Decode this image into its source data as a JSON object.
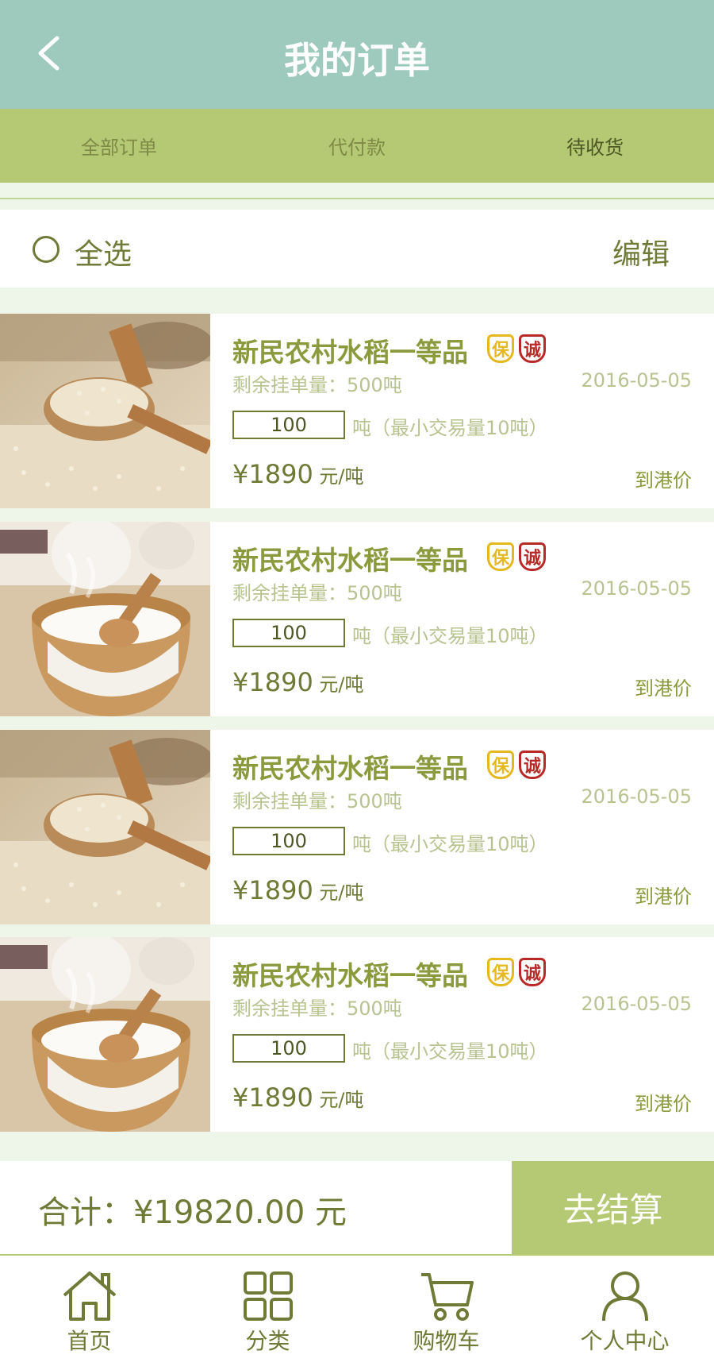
{
  "header": {
    "title": "我的订单",
    "back_icon": "chevron-left-icon"
  },
  "tabs": [
    {
      "label": "全部订单",
      "active": false
    },
    {
      "label": "代付款",
      "active": false
    },
    {
      "label": "待收货",
      "active": true
    }
  ],
  "select_bar": {
    "select_all_label": "全选",
    "edit_label": "编辑"
  },
  "products": [
    {
      "name": "新民农村水稻一等品",
      "badges": [
        "保",
        "诚"
      ],
      "remaining": "剩余挂单量：500吨",
      "date": "2016-05-05",
      "quantity": "100",
      "qty_note": "吨（最小交易量10吨）",
      "price": "¥1890",
      "price_unit": " 元/吨",
      "port_price_label": "到港价",
      "image": "rice-spoon-image"
    },
    {
      "name": "新民农村水稻一等品",
      "badges": [
        "保",
        "诚"
      ],
      "remaining": "剩余挂单量：500吨",
      "date": "2016-05-05",
      "quantity": "100",
      "qty_note": "吨（最小交易量10吨）",
      "price": "¥1890",
      "price_unit": " 元/吨",
      "port_price_label": "到港价",
      "image": "rice-bowl-image"
    },
    {
      "name": "新民农村水稻一等品",
      "badges": [
        "保",
        "诚"
      ],
      "remaining": "剩余挂单量：500吨",
      "date": "2016-05-05",
      "quantity": "100",
      "qty_note": "吨（最小交易量10吨）",
      "price": "¥1890",
      "price_unit": " 元/吨",
      "port_price_label": "到港价",
      "image": "rice-spoon-image"
    },
    {
      "name": "新民农村水稻一等品",
      "badges": [
        "保",
        "诚"
      ],
      "remaining": "剩余挂单量：500吨",
      "date": "2016-05-05",
      "quantity": "100",
      "qty_note": "吨（最小交易量10吨）",
      "price": "¥1890",
      "price_unit": " 元/吨",
      "port_price_label": "到港价",
      "image": "rice-bowl-image"
    }
  ],
  "checkout": {
    "total": "合计：¥19820.00 元",
    "button_label": "去结算"
  },
  "bottom_nav": [
    {
      "label": "首页",
      "icon": "home-icon"
    },
    {
      "label": "分类",
      "icon": "grid-icon"
    },
    {
      "label": "购物车",
      "icon": "cart-icon"
    },
    {
      "label": "个人中心",
      "icon": "user-icon"
    }
  ],
  "colors": {
    "header_bg": "#9dcabc",
    "tabs_bg": "#b5c874",
    "accent": "#6e7a36",
    "light_text": "#b8c391",
    "badge_bao": "#e6b820",
    "badge_cheng": "#b82a28"
  }
}
